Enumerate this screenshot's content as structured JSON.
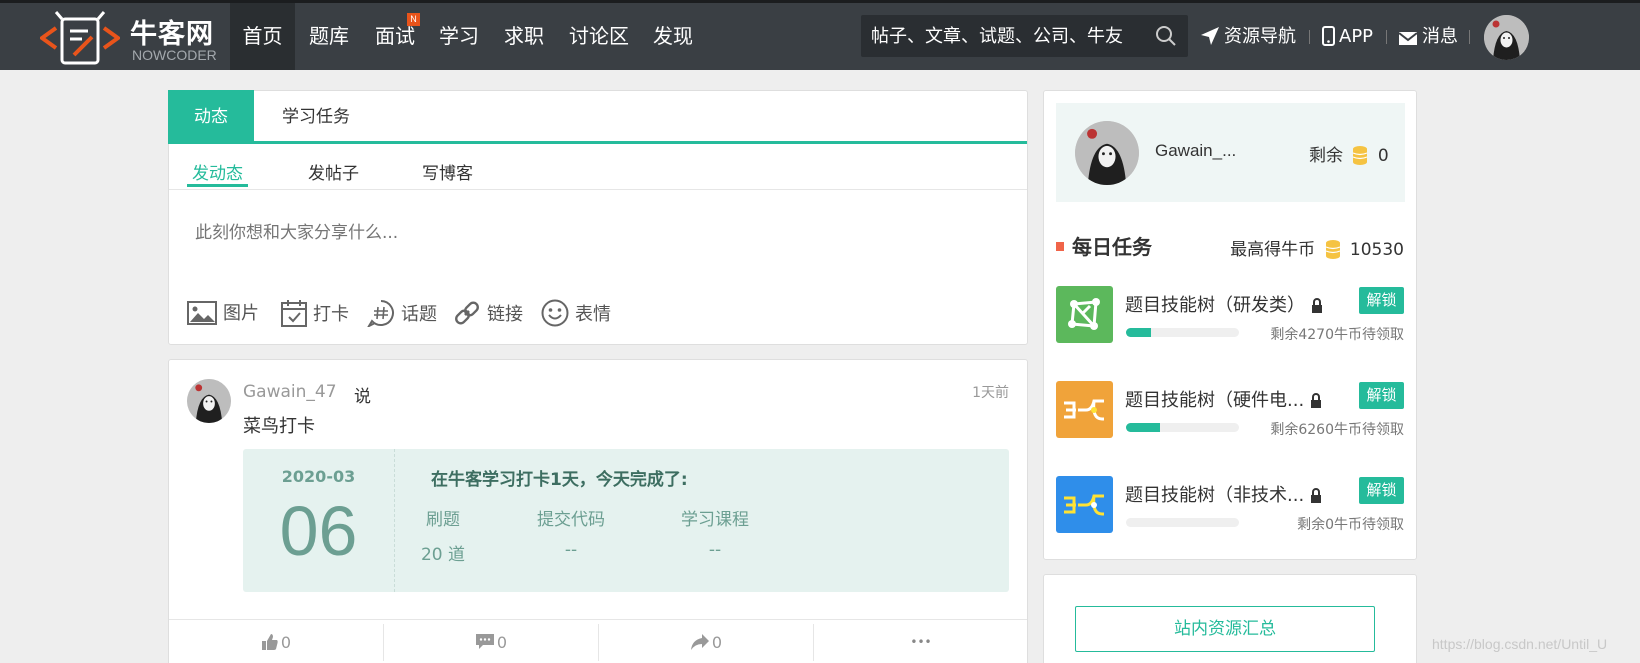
{
  "nav": {
    "logo_cn": "牛客网",
    "logo_en": "NOWCODER",
    "items": [
      {
        "label": "首页",
        "active": true
      },
      {
        "label": "题库"
      },
      {
        "label": "面试",
        "badge": "N"
      },
      {
        "label": "学习"
      },
      {
        "label": "求职"
      },
      {
        "label": "讨论区"
      },
      {
        "label": "发现"
      }
    ],
    "search_placeholder": "帖子、文章、试题、公司、牛友",
    "links": {
      "resources": "资源导航",
      "app": "APP",
      "messages": "消息"
    }
  },
  "feed": {
    "tabs": [
      "动态",
      "学习任务"
    ],
    "subtabs": [
      "发动态",
      "发帖子",
      "写博客"
    ],
    "composer_placeholder": "此刻你想和大家分享什么...",
    "tools": [
      "图片",
      "打卡",
      "话题",
      "链接",
      "表情"
    ]
  },
  "post": {
    "author": "Gawain_47",
    "said": "说",
    "time": "1天前",
    "text": "菜鸟打卡",
    "checkin": {
      "month": "2020-03",
      "day": "06",
      "title": "在牛客学习打卡1天，今天完成了:",
      "headers": [
        "刷题",
        "提交代码",
        "学习课程"
      ],
      "values": [
        "20 道",
        "--",
        "--"
      ]
    },
    "actions": {
      "likes": "0",
      "comments": "0",
      "shares": "0",
      "more": "•••"
    }
  },
  "sidebar": {
    "user": {
      "name": "Gawain_...",
      "remaining_label": "剩余",
      "coins": "0"
    },
    "daily": {
      "title": "每日任务",
      "max_label": "最高得牛币",
      "max_coins": "10530"
    },
    "tasks": [
      {
        "name": "题目技能树（研发类）",
        "unlock": "解锁",
        "progress": 0.22,
        "remain": "剩余4270牛币待领取",
        "color": "#5cb85c"
      },
      {
        "name": "题目技能树（硬件电...",
        "unlock": "解锁",
        "progress": 0.3,
        "remain": "剩余6260牛币待领取",
        "color": "#f0a33a"
      },
      {
        "name": "题目技能树（非技术...",
        "unlock": "解锁",
        "progress": 0.0,
        "remain": "剩余0牛币待领取",
        "color": "#2f8eea"
      }
    ],
    "resources_button": "站内资源汇总"
  },
  "watermark": "https://blog.csdn.net/Until_U",
  "colors": {
    "accent": "#25bb9b",
    "nav_bg": "#3a3f44",
    "coin": "#f5c342",
    "mark": "#f06449"
  }
}
